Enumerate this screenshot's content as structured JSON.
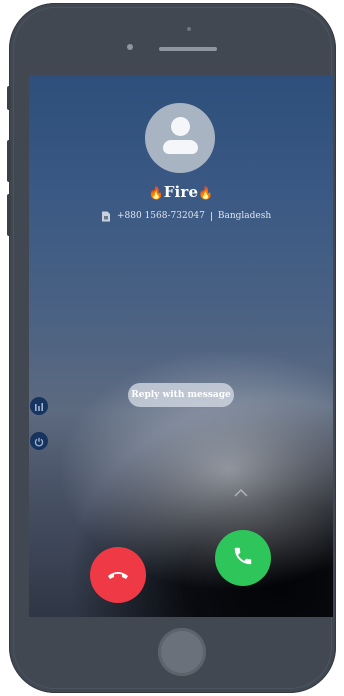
{
  "call": {
    "caller_name": "Fire",
    "name_emoji_left": "🔥",
    "name_emoji_right": "🔥",
    "phone_number": "+880 1568-732047",
    "location": "Bangladesh",
    "reply_label": "Reply with message"
  },
  "icons": {
    "avatar": "person-icon",
    "sim": "sim-card-icon",
    "swipe_up": "chevron-up-icon",
    "decline": "phone-hangup-icon",
    "accept": "phone-icon",
    "side_top": "equalizer-icon",
    "side_bottom": "power-icon"
  },
  "colors": {
    "decline": "#ef3a46",
    "accept": "#2ec55a",
    "phone_body": "#414851"
  }
}
